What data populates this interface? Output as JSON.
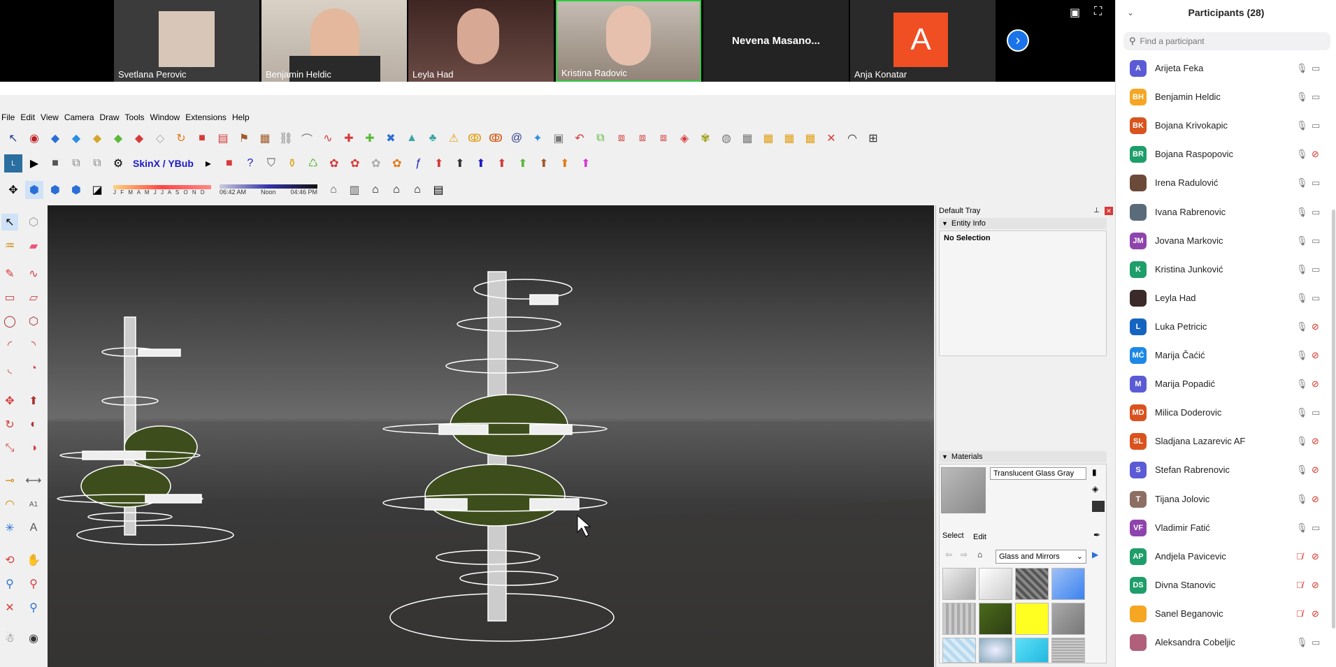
{
  "video": {
    "tiles": [
      {
        "name": "Svetlana Perovic",
        "type": "video",
        "bg": "#3b3b3b"
      },
      {
        "name": "Benjamin Heldic",
        "type": "video",
        "bg": "#c9bfb2"
      },
      {
        "name": "Leyla Had",
        "type": "video",
        "bg": "#5a3a34"
      },
      {
        "name": "Kristina Radovic",
        "type": "video",
        "bg": "#a99c92"
      },
      {
        "name": "Nevena  Masano...",
        "type": "name"
      },
      {
        "name": "Anja Konatar",
        "type": "avatar",
        "initial": "A",
        "color": "#f04e23"
      }
    ]
  },
  "sketchup": {
    "menu": [
      "File",
      "Edit",
      "View",
      "Camera",
      "Draw",
      "Tools",
      "Window",
      "Extensions",
      "Help"
    ],
    "skinx_label": "SkinX / YBub",
    "shadow": {
      "months": "J F M A M J J A S O N D",
      "time_start": "06:42 AM",
      "time_mid": "Noon",
      "time_end": "04:46 PM"
    },
    "tray": {
      "title": "Default Tray",
      "entity_info": {
        "title": "Entity Info",
        "status": "No Selection"
      },
      "materials": {
        "title": "Materials",
        "current": "Translucent Glass Gray",
        "tab_select": "Select",
        "tab_edit": "Edit",
        "library": "Glass and Mirrors"
      }
    }
  },
  "participants": {
    "title": "Participants (28)",
    "search_placeholder": "Find a participant",
    "list": [
      {
        "name": "Arijeta Feka",
        "initials": "A",
        "color": "#5b5bd6",
        "mic_muted": false,
        "cam_off": false
      },
      {
        "name": "Benjamin Heldic",
        "initials": "BH",
        "color": "#f5a623",
        "mic_muted": false,
        "cam_off": false
      },
      {
        "name": "Bojana Krivokapic",
        "initials": "BK",
        "color": "#d9531e",
        "mic_muted": false,
        "cam_off": false
      },
      {
        "name": "Bojana Raspopovic",
        "initials": "BR",
        "color": "#1e9e6a",
        "mic_muted": false,
        "cam_off": true
      },
      {
        "name": "Irena Radulović",
        "initials": "",
        "color": "#6b4a3a",
        "mic_muted": false,
        "cam_off": false
      },
      {
        "name": "Ivana Rabrenovic",
        "initials": "",
        "color": "#5a6b7a",
        "mic_muted": false,
        "cam_off": false
      },
      {
        "name": "Jovana Markovic",
        "initials": "JM",
        "color": "#8e44ad",
        "mic_muted": false,
        "cam_off": false
      },
      {
        "name": "Kristina Junković",
        "initials": "K",
        "color": "#1e9e6a",
        "mic_muted": false,
        "cam_off": false
      },
      {
        "name": "Leyla Had",
        "initials": "",
        "color": "#3a2a2a",
        "mic_muted": false,
        "cam_off": false
      },
      {
        "name": "Luka Petricic",
        "initials": "L",
        "color": "#1565c0",
        "mic_muted": false,
        "cam_off": true
      },
      {
        "name": "Marija Čaćić",
        "initials": "MĆ",
        "color": "#1e88e5",
        "mic_muted": false,
        "cam_off": true
      },
      {
        "name": "Marija Popadić",
        "initials": "M",
        "color": "#5b5bd6",
        "mic_muted": false,
        "cam_off": true
      },
      {
        "name": "Milica Doderovic",
        "initials": "MD",
        "color": "#d9531e",
        "mic_muted": false,
        "cam_off": false
      },
      {
        "name": "Sladjana Lazarevic AF",
        "initials": "SL",
        "color": "#d9531e",
        "mic_muted": false,
        "cam_off": true
      },
      {
        "name": "Stefan Rabrenovic",
        "initials": "S",
        "color": "#5b5bd6",
        "mic_muted": false,
        "cam_off": true
      },
      {
        "name": "Tijana Jolovic",
        "initials": "T",
        "color": "#8d6e63",
        "mic_muted": false,
        "cam_off": true
      },
      {
        "name": "Vladimir Fatić",
        "initials": "VF",
        "color": "#8e44ad",
        "mic_muted": false,
        "cam_off": false
      },
      {
        "name": "Andjela Pavicevic",
        "initials": "AP",
        "color": "#1e9e6a",
        "mic_muted": true,
        "cam_off": true
      },
      {
        "name": "Divna Stanovic",
        "initials": "DS",
        "color": "#1e9e6a",
        "mic_muted": true,
        "cam_off": true
      },
      {
        "name": "Sanel Beganovic",
        "initials": "",
        "color": "#f5a623",
        "mic_muted": true,
        "cam_off": true
      },
      {
        "name": "Aleksandra Cobeljic",
        "initials": "",
        "color": "#b0607a",
        "mic_muted": false,
        "cam_off": false
      }
    ]
  }
}
